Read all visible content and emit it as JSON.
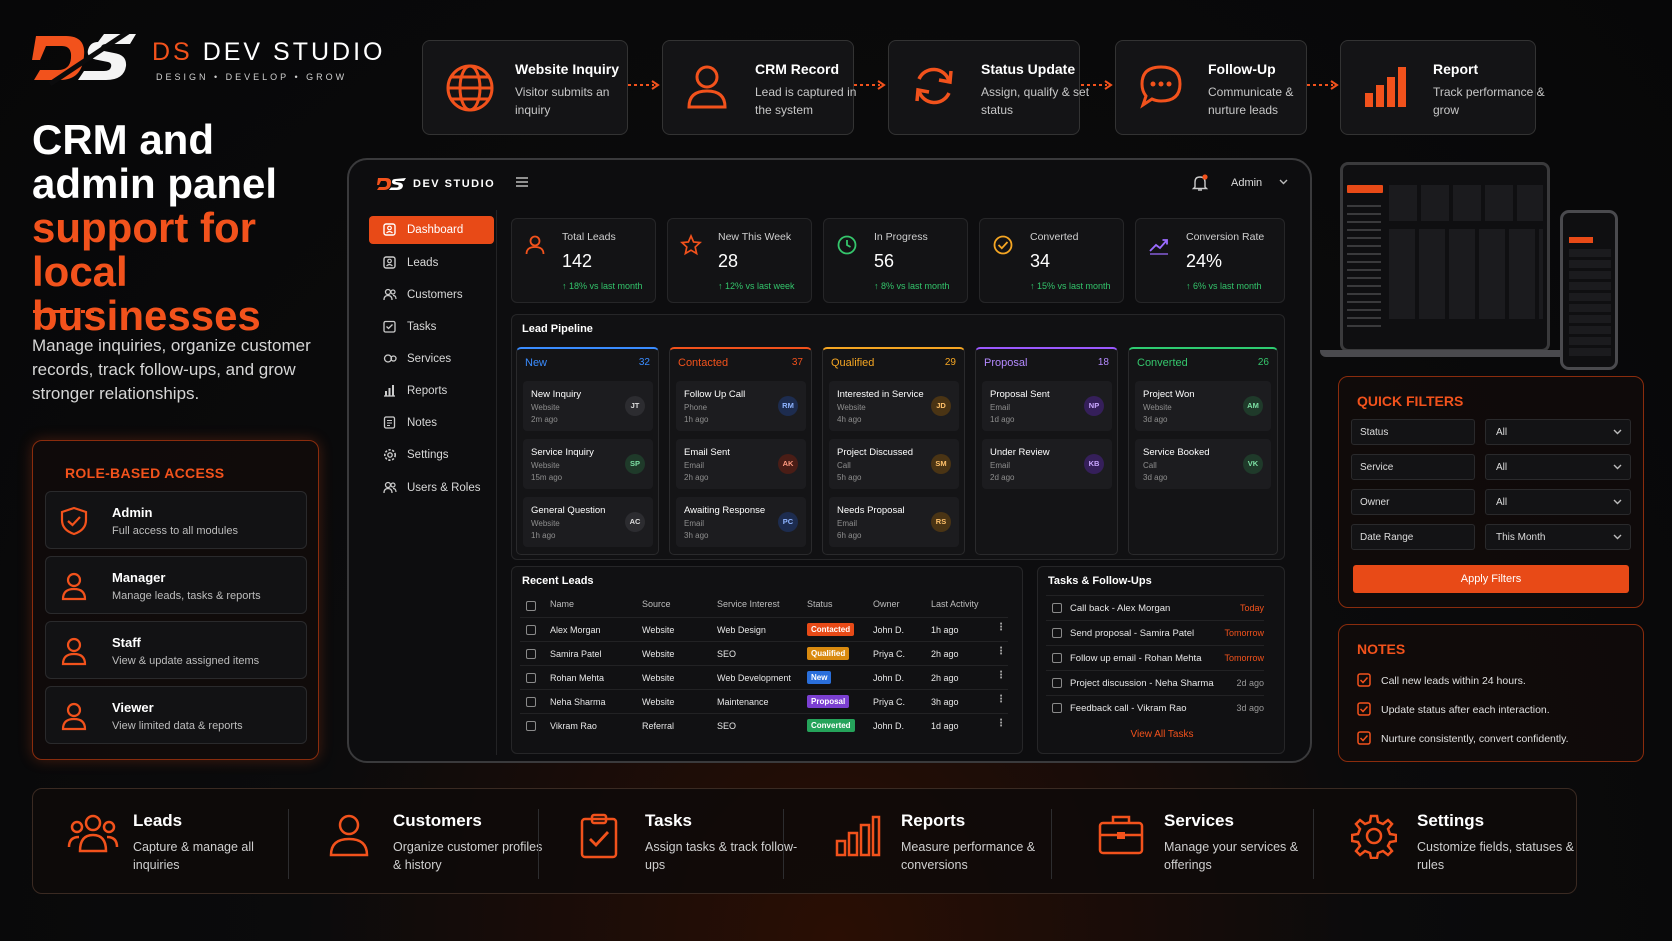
{
  "brand": {
    "logo_text": "DS",
    "prefix": "DS",
    "name": "DEV STUDIO",
    "tagline": "DESIGN • DEVELOP • GROW"
  },
  "hero": {
    "title_line1": "CRM and",
    "title_line2": "admin panel",
    "accent_line1": "support for",
    "accent_line2": "local businesses",
    "description": "Manage inquiries, organize customer records, track follow-ups, and grow stronger relationships."
  },
  "roles": {
    "title": "ROLE-BASED ACCESS",
    "items": [
      {
        "name": "Admin",
        "desc": "Full access to all modules",
        "icon": "shield-check-icon"
      },
      {
        "name": "Manager",
        "desc": "Manage leads, tasks & reports",
        "icon": "user-icon"
      },
      {
        "name": "Staff",
        "desc": "View & update assigned items",
        "icon": "user-icon"
      },
      {
        "name": "Viewer",
        "desc": "View limited data & reports",
        "icon": "user-icon"
      }
    ]
  },
  "flow": [
    {
      "title": "Website Inquiry",
      "desc": "Visitor submits an inquiry",
      "icon": "globe-icon"
    },
    {
      "title": "CRM Record",
      "desc": "Lead is captured in the system",
      "icon": "user-icon"
    },
    {
      "title": "Status Update",
      "desc": "Assign, qualify & set status",
      "icon": "refresh-icon"
    },
    {
      "title": "Follow-Up",
      "desc": "Communicate & nurture leads",
      "icon": "chat-icon"
    },
    {
      "title": "Report",
      "desc": "Track performance & grow",
      "icon": "bar-chart-icon"
    }
  ],
  "dashboard": {
    "brand": "DEV STUDIO",
    "user": "Admin",
    "sidebar": [
      {
        "label": "Dashboard",
        "icon": "dashboard-icon",
        "active": true
      },
      {
        "label": "Leads",
        "icon": "leads-icon"
      },
      {
        "label": "Customers",
        "icon": "customers-icon"
      },
      {
        "label": "Tasks",
        "icon": "tasks-icon"
      },
      {
        "label": "Services",
        "icon": "services-icon"
      },
      {
        "label": "Reports",
        "icon": "reports-icon"
      },
      {
        "label": "Notes",
        "icon": "notes-icon"
      },
      {
        "label": "Settings",
        "icon": "settings-icon"
      },
      {
        "label": "Users & Roles",
        "icon": "users-roles-icon"
      }
    ],
    "kpis": [
      {
        "label": "Total Leads",
        "value": "142",
        "delta": "↑ 18% vs last month",
        "icon": "user-icon"
      },
      {
        "label": "New This Week",
        "value": "28",
        "delta": "↑ 12% vs last week",
        "icon": "star-icon"
      },
      {
        "label": "In Progress",
        "value": "56",
        "delta": "↑ 8% vs last month",
        "icon": "clock-icon"
      },
      {
        "label": "Converted",
        "value": "34",
        "delta": "↑ 15% vs last month",
        "icon": "check-circle-icon"
      },
      {
        "label": "Conversion Rate",
        "value": "24%",
        "delta": "↑ 6% vs last month",
        "icon": "trend-icon"
      }
    ],
    "pipeline": {
      "title": "Lead Pipeline",
      "columns": [
        {
          "name": "New",
          "count": "32",
          "color": "#3a8cff",
          "cards": [
            {
              "title": "New Inquiry",
              "source": "Website",
              "time": "2m ago",
              "initials": "JT"
            },
            {
              "title": "Service Inquiry",
              "source": "Website",
              "time": "15m ago",
              "initials": "SP"
            },
            {
              "title": "General Question",
              "source": "Website",
              "time": "1h ago",
              "initials": "AC"
            }
          ]
        },
        {
          "name": "Contacted",
          "count": "37",
          "color": "#f2521c",
          "cards": [
            {
              "title": "Follow Up Call",
              "source": "Phone",
              "time": "1h ago",
              "initials": "RM"
            },
            {
              "title": "Email Sent",
              "source": "Email",
              "time": "2h ago",
              "initials": "AK"
            },
            {
              "title": "Awaiting Response",
              "source": "Email",
              "time": "3h ago",
              "initials": "PC"
            }
          ]
        },
        {
          "name": "Qualified",
          "count": "29",
          "color": "#f5a623",
          "cards": [
            {
              "title": "Interested in Service",
              "source": "Website",
              "time": "4h ago",
              "initials": "JD"
            },
            {
              "title": "Project Discussed",
              "source": "Call",
              "time": "5h ago",
              "initials": "SM"
            },
            {
              "title": "Needs Proposal",
              "source": "Email",
              "time": "6h ago",
              "initials": "RS"
            }
          ]
        },
        {
          "name": "Proposal",
          "count": "18",
          "color": "#9b59ff",
          "cards": [
            {
              "title": "Proposal Sent",
              "source": "Email",
              "time": "1d ago",
              "initials": "NP"
            },
            {
              "title": "Under Review",
              "source": "Email",
              "time": "2d ago",
              "initials": "KB"
            }
          ]
        },
        {
          "name": "Converted",
          "count": "26",
          "color": "#2ecc71",
          "cards": [
            {
              "title": "Project Won",
              "source": "Website",
              "time": "3d ago",
              "initials": "AM"
            },
            {
              "title": "Service Booked",
              "source": "Call",
              "time": "3d ago",
              "initials": "VK"
            }
          ]
        }
      ]
    },
    "recent_leads": {
      "title": "Recent Leads",
      "headers": [
        "Name",
        "Source",
        "Service Interest",
        "Status",
        "Owner",
        "Last Activity"
      ],
      "rows": [
        {
          "name": "Alex Morgan",
          "source": "Website",
          "service": "Web Design",
          "status": "Contacted",
          "status_color": "#e84a17",
          "owner": "John D.",
          "activity": "1h ago"
        },
        {
          "name": "Samira Patel",
          "source": "Website",
          "service": "SEO",
          "status": "Qualified",
          "status_color": "#d98a0f",
          "owner": "Priya C.",
          "activity": "2h ago"
        },
        {
          "name": "Rohan Mehta",
          "source": "Website",
          "service": "Web Development",
          "status": "New",
          "status_color": "#2a6fdb",
          "owner": "John D.",
          "activity": "2h ago"
        },
        {
          "name": "Neha Sharma",
          "source": "Website",
          "service": "Maintenance",
          "status": "Proposal",
          "status_color": "#7b3fd1",
          "owner": "Priya C.",
          "activity": "3h ago"
        },
        {
          "name": "Vikram Rao",
          "source": "Referral",
          "service": "SEO",
          "status": "Converted",
          "status_color": "#25a35a",
          "owner": "John D.",
          "activity": "1d ago"
        }
      ]
    },
    "tasks": {
      "title": "Tasks & Follow-Ups",
      "items": [
        {
          "text": "Call back - Alex Morgan",
          "when": "Today",
          "color": "#f2521c"
        },
        {
          "text": "Send proposal - Samira Patel",
          "when": "Tomorrow",
          "color": "#f2521c"
        },
        {
          "text": "Follow up email - Rohan Mehta",
          "when": "Tomorrow",
          "color": "#f2521c"
        },
        {
          "text": "Project discussion - Neha Sharma",
          "when": "2d ago",
          "color": "#9a9a9a"
        },
        {
          "text": "Feedback call - Vikram Rao",
          "when": "3d ago",
          "color": "#9a9a9a"
        }
      ],
      "view_all": "View All Tasks"
    }
  },
  "quick_filters": {
    "title": "QUICK FILTERS",
    "filters": [
      {
        "label": "Status",
        "value": "All"
      },
      {
        "label": "Service",
        "value": "All"
      },
      {
        "label": "Owner",
        "value": "All"
      },
      {
        "label": "Date Range",
        "value": "This Month"
      }
    ],
    "apply": "Apply Filters"
  },
  "notes": {
    "title": "NOTES",
    "items": [
      "Call new leads within 24 hours.",
      "Update status after each interaction.",
      "Nurture consistently, convert confidently."
    ]
  },
  "features": [
    {
      "title": "Leads",
      "desc": "Capture & manage all inquiries",
      "icon": "users-group-icon"
    },
    {
      "title": "Customers",
      "desc": "Organize customer profiles & history",
      "icon": "user-icon"
    },
    {
      "title": "Tasks",
      "desc": "Assign tasks & track follow-ups",
      "icon": "clipboard-check-icon"
    },
    {
      "title": "Reports",
      "desc": "Measure performance & conversions",
      "icon": "bar-chart-icon"
    },
    {
      "title": "Services",
      "desc": "Manage your services & offerings",
      "icon": "briefcase-icon"
    },
    {
      "title": "Settings",
      "desc": "Customize fields, statuses & rules",
      "icon": "gear-icon"
    }
  ],
  "colors": {
    "accent": "#f2521c",
    "background": "#0b0b0c",
    "success": "#33c46b"
  }
}
